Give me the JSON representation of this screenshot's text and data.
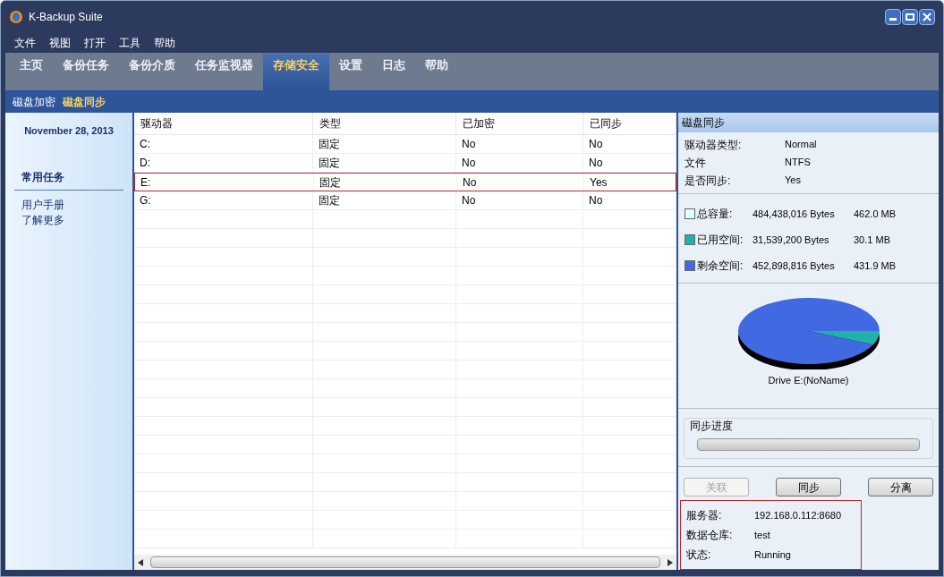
{
  "window": {
    "title": "K-Backup Suite"
  },
  "menu": [
    "文件",
    "视图",
    "打开",
    "工具",
    "帮助"
  ],
  "tabs": [
    {
      "label": "主页",
      "selected": false
    },
    {
      "label": "备份任务",
      "selected": false
    },
    {
      "label": "备份介质",
      "selected": false
    },
    {
      "label": "任务监视器",
      "selected": false
    },
    {
      "label": "存储安全",
      "selected": true
    },
    {
      "label": "设置",
      "selected": false
    },
    {
      "label": "日志",
      "selected": false
    },
    {
      "label": "帮助",
      "selected": false
    }
  ],
  "subtabs": [
    {
      "label": "磁盘加密",
      "selected": false
    },
    {
      "label": "磁盘同步",
      "selected": true
    }
  ],
  "sidebar": {
    "date": "November 28, 2013",
    "section_title": "常用任务",
    "links": [
      "用户手册",
      "了解更多"
    ]
  },
  "table": {
    "columns": [
      "驱动器",
      "类型",
      "已加密",
      "已同步"
    ],
    "rows": [
      {
        "cells": [
          "C:",
          "固定",
          "No",
          "No"
        ],
        "selected": false
      },
      {
        "cells": [
          "D:",
          "固定",
          "No",
          "No"
        ],
        "selected": false
      },
      {
        "cells": [
          "E:",
          "固定",
          "No",
          "Yes"
        ],
        "selected": true
      },
      {
        "cells": [
          "G:",
          "固定",
          "No",
          "No"
        ],
        "selected": false
      }
    ]
  },
  "panel": {
    "title": "磁盘同步",
    "properties": [
      {
        "label": "驱动器类型:",
        "value": "Normal"
      },
      {
        "label": "文件",
        "value": "NTFS"
      },
      {
        "label": "是否同步:",
        "value": "Yes"
      }
    ],
    "legend": [
      {
        "label": "总容量:",
        "bytes": "484,438,016 Bytes",
        "size": "462.0 MB",
        "color": "#e0ffff"
      },
      {
        "label": "已用空间:",
        "bytes": "31,539,200 Bytes",
        "size": "30.1 MB",
        "color": "#20b2aa"
      },
      {
        "label": "剩余空间:",
        "bytes": "452,898,816 Bytes",
        "size": "431.9 MB",
        "color": "#4169e1"
      }
    ],
    "chart_title": "Drive E:(NoName)",
    "progress": {
      "label": "同步进度",
      "level": 0
    },
    "buttons": [
      {
        "label": "关联",
        "disabled": true
      },
      {
        "label": "同步",
        "disabled": false
      },
      {
        "label": "分离",
        "disabled": false
      }
    ],
    "server_info": [
      {
        "label": "服务器:",
        "value": "192.168.0.112:8680"
      },
      {
        "label": "数据仓库:",
        "value": "test"
      },
      {
        "label": "状态:",
        "value": "Running"
      }
    ]
  }
}
